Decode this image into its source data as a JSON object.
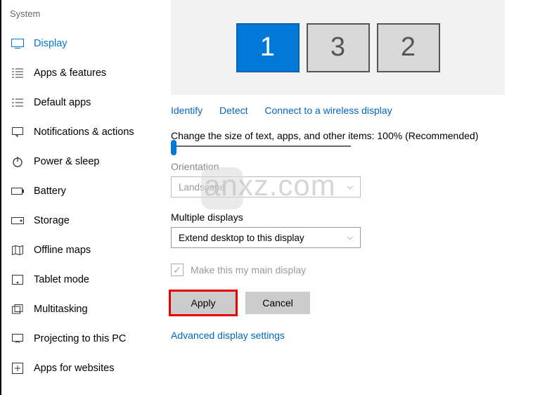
{
  "sidebar": {
    "title": "System",
    "items": [
      {
        "label": "Display"
      },
      {
        "label": "Apps & features"
      },
      {
        "label": "Default apps"
      },
      {
        "label": "Notifications & actions"
      },
      {
        "label": "Power & sleep"
      },
      {
        "label": "Battery"
      },
      {
        "label": "Storage"
      },
      {
        "label": "Offline maps"
      },
      {
        "label": "Tablet mode"
      },
      {
        "label": "Multitasking"
      },
      {
        "label": "Projecting to this PC"
      },
      {
        "label": "Apps for websites"
      }
    ]
  },
  "display_arrangement": {
    "monitors": [
      "1",
      "3",
      "2"
    ],
    "primary_index": 0
  },
  "links": {
    "identify": "Identify",
    "detect": "Detect",
    "wireless": "Connect to a wireless display"
  },
  "scale": {
    "label": "Change the size of text, apps, and other items: 100% (Recommended)"
  },
  "orientation": {
    "label": "Orientation",
    "value": "Landscape"
  },
  "multiple_displays": {
    "label": "Multiple displays",
    "value": "Extend desktop to this display"
  },
  "main_display": {
    "label": "Make this my main display"
  },
  "buttons": {
    "apply": "Apply",
    "cancel": "Cancel"
  },
  "advanced_link": "Advanced display settings",
  "watermark": "anxz.com"
}
